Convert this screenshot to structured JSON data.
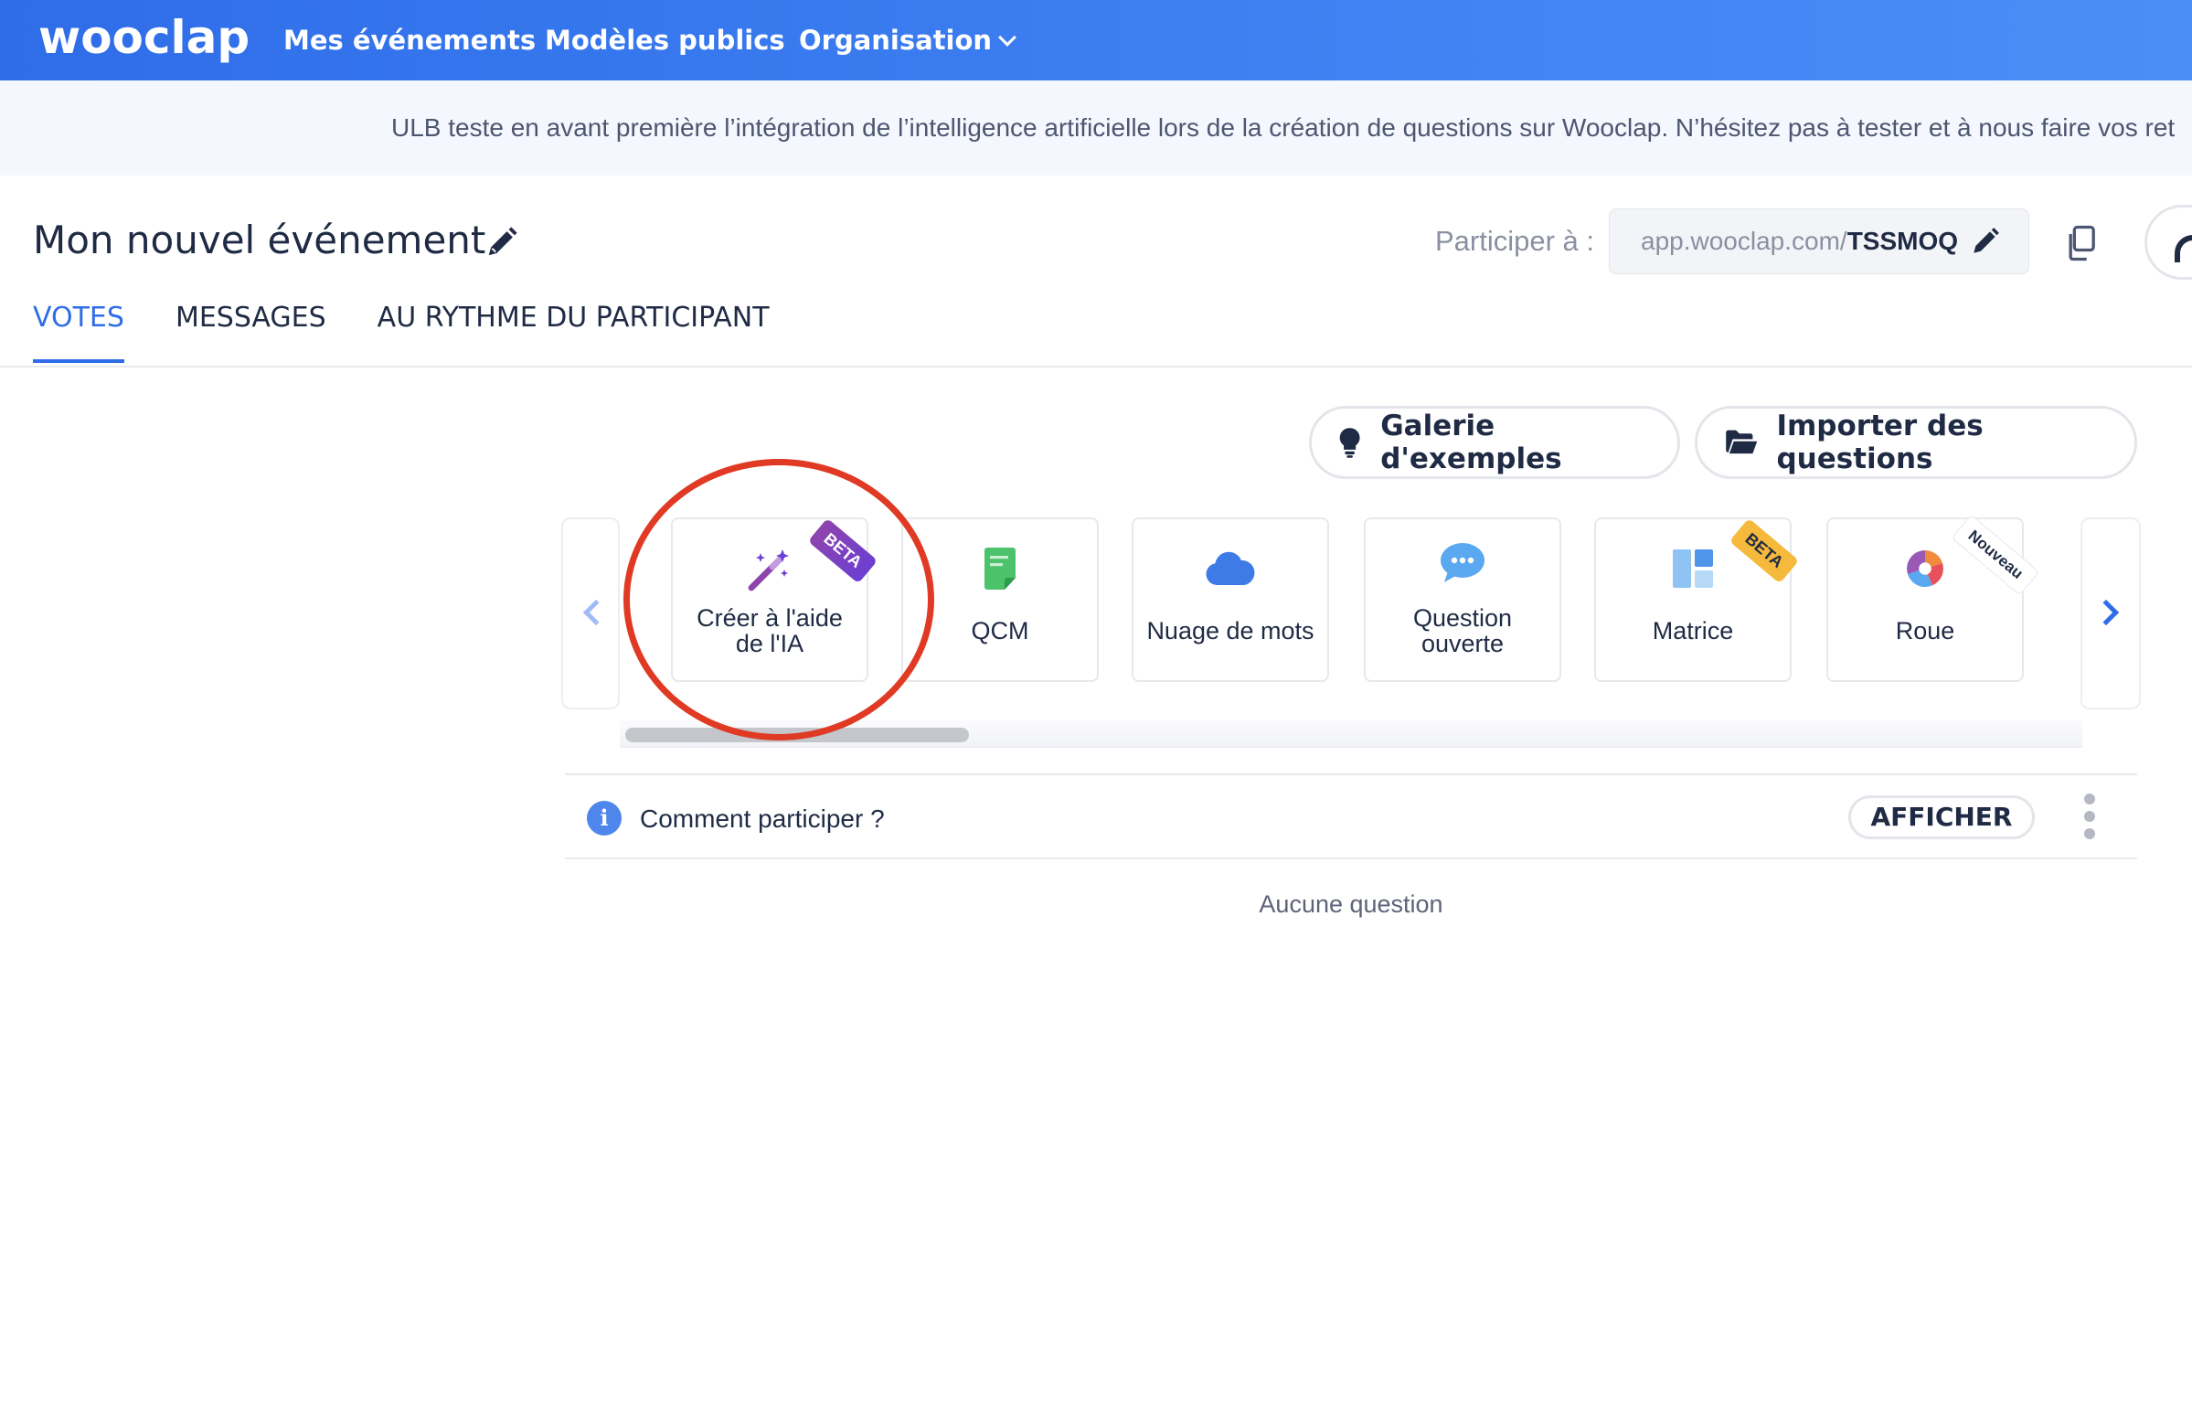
{
  "nav": {
    "logo": "wooclap",
    "items": [
      "Mes événements",
      "Modèles publics",
      "Organisation"
    ]
  },
  "banner": {
    "text": "ULB teste en avant première l’intégration de l’intelligence artificielle lors de la création de questions sur Wooclap. N’hésitez pas à tester et à nous faire vos ret"
  },
  "event": {
    "title": "Mon nouvel événement",
    "participate_label": "Participer à :",
    "url_prefix": "app.wooclap.com/",
    "url_code": "TSSMOQ"
  },
  "tabs": [
    {
      "label": "VOTES",
      "active": true
    },
    {
      "label": "MESSAGES",
      "active": false
    },
    {
      "label": "AU RYTHME DU PARTICIPANT",
      "active": false
    }
  ],
  "actions": {
    "gallery": "Galerie d'exemples",
    "import": "Importer des questions"
  },
  "cards": [
    {
      "line1": "Créer à l'aide",
      "line2": "de l'IA",
      "icon": "magic-wand-icon",
      "badge": "BETA"
    },
    {
      "line1": "QCM",
      "line2": "",
      "icon": "qcm-icon",
      "badge": ""
    },
    {
      "line1": "Nuage de mots",
      "line2": "",
      "icon": "cloud-icon",
      "badge": ""
    },
    {
      "line1": "Question",
      "line2": "ouverte",
      "icon": "speech-bubble-icon",
      "badge": ""
    },
    {
      "line1": "Matrice",
      "line2": "",
      "icon": "matrix-icon",
      "badge": "BETA"
    },
    {
      "line1": "Roue",
      "line2": "",
      "icon": "wheel-icon",
      "badge": "Nouveau"
    }
  ],
  "participate": {
    "text": "Comment participer ?",
    "show_button": "AFFICHER",
    "info_glyph": "i"
  },
  "empty_state": "Aucune question",
  "colors": {
    "primary": "#2f6de8",
    "annotation_circle": "#e03a24",
    "beta_purple": "#6b3fd1",
    "beta_yellow": "#f5b93b"
  }
}
